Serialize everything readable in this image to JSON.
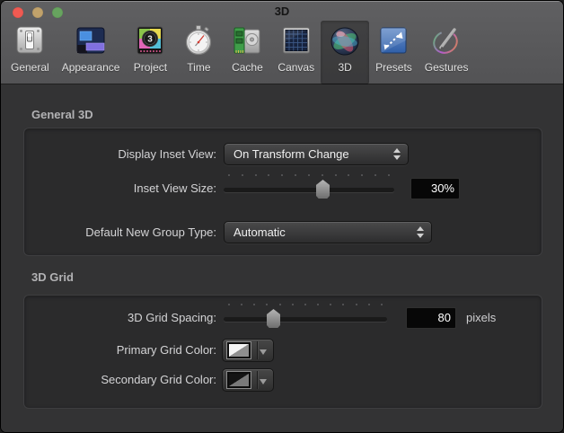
{
  "window": {
    "title": "3D",
    "traffic_lights": {
      "close_color": "#ef5a52",
      "minimize_color": "#c1a26b",
      "zoom_color": "#67a45f"
    }
  },
  "toolbar": {
    "selected": "3D",
    "items": [
      {
        "label": "General",
        "icon": "light-switch-icon"
      },
      {
        "label": "Appearance",
        "icon": "appearance-icon"
      },
      {
        "label": "Project",
        "icon": "countdown-icon"
      },
      {
        "label": "Time",
        "icon": "stopwatch-icon"
      },
      {
        "label": "Cache",
        "icon": "memory-disk-icon"
      },
      {
        "label": "Canvas",
        "icon": "grid-canvas-icon"
      },
      {
        "label": "3D",
        "icon": "sphere-3d-icon"
      },
      {
        "label": "Presets",
        "icon": "resize-arrow-icon"
      },
      {
        "label": "Gestures",
        "icon": "pen-circle-icon"
      }
    ]
  },
  "general3d": {
    "heading": "General 3D",
    "display_inset_view": {
      "label": "Display Inset View:",
      "value": "On Transform Change"
    },
    "inset_view_size": {
      "label": "Inset View Size:",
      "value": "30%",
      "thumb_percent": 58
    },
    "default_new_group_type": {
      "label": "Default New Group Type:",
      "value": "Automatic"
    }
  },
  "grid3d": {
    "heading": "3D Grid",
    "grid_spacing": {
      "label": "3D Grid Spacing:",
      "value": "80",
      "unit": "pixels",
      "thumb_percent": 28
    },
    "primary_grid_color": {
      "label": "Primary Grid Color:",
      "swatch_top_left": "#f4f4f4",
      "swatch_bottom_right": "#8e8e8e"
    },
    "secondary_grid_color": {
      "label": "Secondary Grid Color:",
      "swatch_top_left": "#141414",
      "swatch_bottom_right": "#7a7a7a"
    }
  }
}
